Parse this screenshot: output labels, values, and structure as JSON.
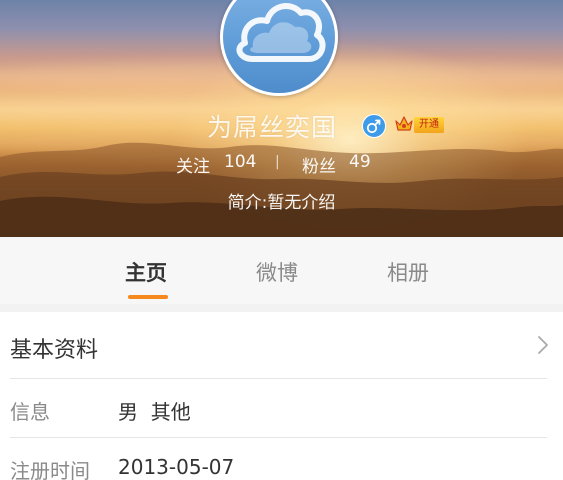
{
  "profile": {
    "nickname": "为屌丝奕国",
    "vip_badge": "开通",
    "follow_label": "关注",
    "follow_count": "104",
    "separator": "|",
    "fans_label": "粉丝",
    "fans_count": "49",
    "intro": "简介:暂无介绍",
    "gender_icon": "male-icon",
    "vip_icon": "crown-icon"
  },
  "tabs": [
    {
      "label": "主页",
      "active": true
    },
    {
      "label": "微博",
      "active": false
    },
    {
      "label": "相册",
      "active": false
    }
  ],
  "basic_info": {
    "title": "基本资料",
    "rows": [
      {
        "label": "信息",
        "value": "男  其他"
      },
      {
        "label": "注册时间",
        "value": "2013-05-07"
      }
    ]
  },
  "colors": {
    "accent": "#f5891e",
    "gender": "#3d9be9",
    "vip": "#f2a31a"
  }
}
